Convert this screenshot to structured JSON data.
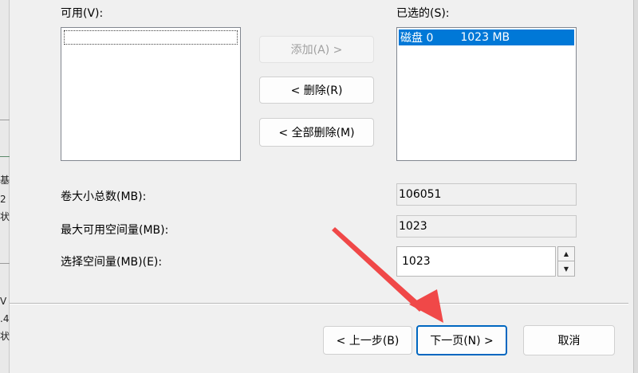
{
  "available": {
    "label": "可用(V):"
  },
  "selected": {
    "label": "已选的(S):",
    "items": [
      {
        "name": "磁盘 0",
        "size": "1023 MB"
      }
    ]
  },
  "buttons": {
    "add": "添加(A) >",
    "remove": "< 删除(R)",
    "remove_all": "< 全部删除(M)",
    "back": "< 上一步(B)",
    "next": "下一页(N) >",
    "cancel": "取消"
  },
  "fields": {
    "total_size": {
      "label": "卷大小总数(MB):",
      "value": "106051"
    },
    "max_space": {
      "label": "最大可用空间量(MB):",
      "value": "1023"
    },
    "select_space": {
      "label": "选择空间量(MB)(E):",
      "value": "1023"
    }
  },
  "background_window": {
    "chars": [
      "基",
      "2",
      "状",
      "V",
      ".4",
      "状"
    ]
  },
  "colors": {
    "selection": "#0078d7",
    "annotation_arrow": "#f04848",
    "default_button_border": "#0067c0"
  },
  "icons": {
    "spin_up": "▲",
    "spin_down": "▼"
  }
}
